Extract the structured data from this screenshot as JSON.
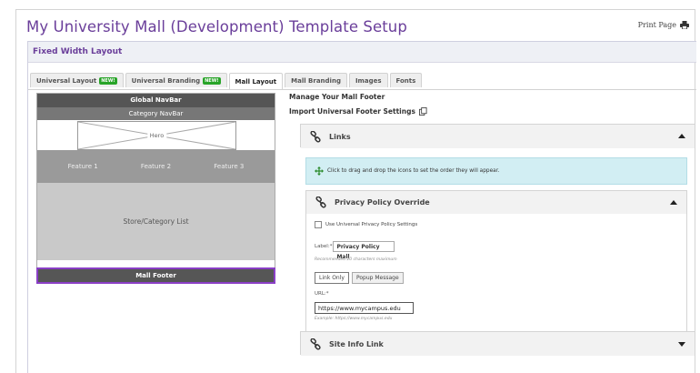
{
  "page": {
    "title": "My University Mall (Development) Template Setup",
    "print_label": "Print Page"
  },
  "section": {
    "title": "Fixed Width Layout"
  },
  "tabs": [
    {
      "label": "Universal Layout",
      "badge": "NEW!"
    },
    {
      "label": "Universal Branding",
      "badge": "NEW!"
    },
    {
      "label": "Mall Layout",
      "active": true
    },
    {
      "label": "Mall Branding"
    },
    {
      "label": "Images"
    },
    {
      "label": "Fonts"
    }
  ],
  "wireframe": {
    "global_nav": "Global NavBar",
    "category_nav": "Category NavBar",
    "hero": "Hero",
    "features": [
      "Feature 1",
      "Feature 2",
      "Feature 3"
    ],
    "store_list": "Store/Category List",
    "footer": "Mall Footer"
  },
  "footer_manager": {
    "title": "Manage Your Mall Footer",
    "import_label": "Import Universal Footer Settings",
    "links_panel": {
      "title": "Links"
    },
    "info_text": "Click to drag and drop the icons to set the order they will appear.",
    "privacy": {
      "title": "Privacy Policy Override",
      "use_universal_label": "Use Universal Privacy Policy Settings",
      "label_caption": "Label:*",
      "label_value": "Privacy Policy Mall",
      "label_hint": "Recommended 20 characters maximum",
      "link_only_label": "Link Only",
      "popup_label": "Popup Message",
      "url_caption": "URL:*",
      "url_value": "https://www.mycampus.edu",
      "url_hint": "Example: https://www.mycampus.edu"
    },
    "site_info": {
      "title": "Site Info Link"
    }
  }
}
